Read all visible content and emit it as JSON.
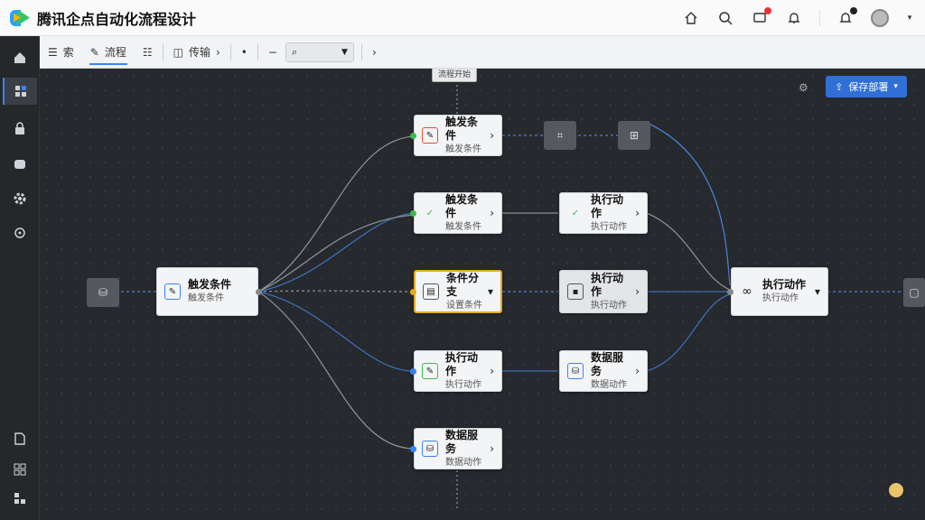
{
  "app": {
    "title": "腾讯企点自动化流程设计"
  },
  "toolbar": {
    "items": [
      {
        "label": "索",
        "icon": "menu-icon"
      },
      {
        "label": "流程",
        "icon": "wand-icon"
      },
      {
        "label": "",
        "icon": "list-icon"
      },
      {
        "label": "传输",
        "icon": "window-icon"
      },
      {
        "label": "",
        "icon": "dot-icon"
      },
      {
        "label": "",
        "icon": "minus-icon"
      }
    ],
    "search_placeholder": "",
    "next": "›"
  },
  "deploy_button": {
    "label": "保存部署"
  },
  "top_tag": {
    "label": "流程开始"
  },
  "nodes": {
    "n1": {
      "title": "触发条件",
      "sub": "触发条件"
    },
    "n2": {
      "title": "触发条件",
      "sub": "触发条件"
    },
    "n3": {
      "title": "条件分支",
      "sub": "设置条件"
    },
    "n4": {
      "title": "执行动作",
      "sub": "执行动作"
    },
    "n5": {
      "title": "数据服务",
      "sub": "数据动作"
    },
    "n6": {
      "title": "触发条件",
      "sub": "触发条件"
    },
    "n7": {
      "title": "执行动作",
      "sub": "执行动作"
    },
    "n8": {
      "title": "执行动作",
      "sub": "执行动作"
    },
    "n9": {
      "title": "执行动作",
      "sub": "执行动作"
    }
  },
  "colors": {
    "accent": "#3b82f6",
    "deploy": "#2f6fd6",
    "selected": "#e5a91e",
    "port_green": "#3fb950"
  }
}
